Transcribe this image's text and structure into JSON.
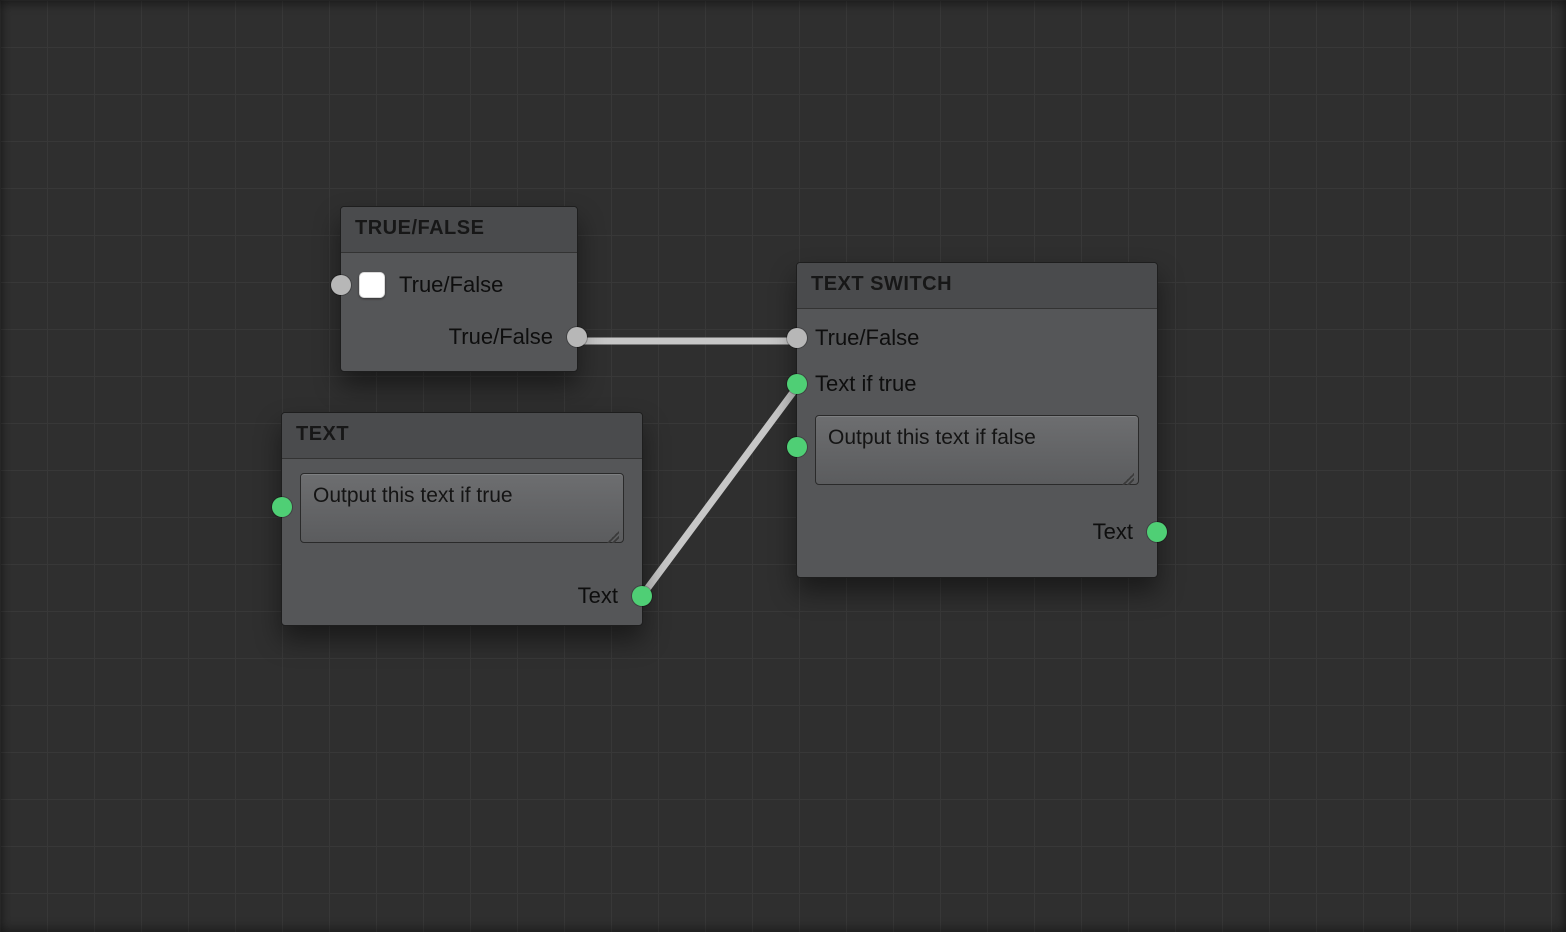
{
  "nodes": {
    "true_false": {
      "title": "TRUE/FALSE",
      "checkbox_label": "True/False",
      "output_label": "True/False"
    },
    "text": {
      "title": "TEXT",
      "textarea_value": "Output this text if true",
      "output_label": "Text"
    },
    "text_switch": {
      "title": "TEXT SWITCH",
      "input_bool_label": "True/False",
      "input_text_true_label": "Text if true",
      "textarea_false_value": "Output this text if false",
      "output_label": "Text"
    }
  },
  "colors": {
    "port_bool": "#b7b7b7",
    "port_text": "#4fcf75",
    "wire": "#c7c7c7"
  }
}
